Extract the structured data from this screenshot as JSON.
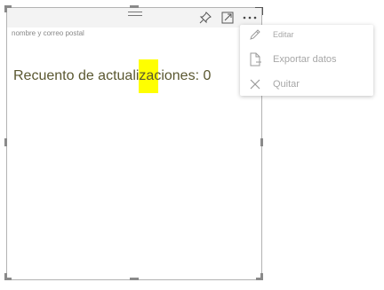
{
  "tile": {
    "subtitle": "nombre y correo postal",
    "value_text": "Recuento de actualizaciones: 0",
    "icons": {
      "pin": "pin-icon",
      "focus": "focus-mode-icon",
      "more": "more-options-icon"
    }
  },
  "context_menu": {
    "items": [
      {
        "label": "Editar",
        "icon": "pencil-icon"
      },
      {
        "label": "Exportar datos",
        "icon": "export-file-icon"
      },
      {
        "label": "Quitar",
        "icon": "close-icon"
      }
    ]
  },
  "colors": {
    "highlight": "#ffff00",
    "value_text": "#5a5730",
    "menu_text": "#a7a7a7",
    "border": "#b3b3b3"
  }
}
